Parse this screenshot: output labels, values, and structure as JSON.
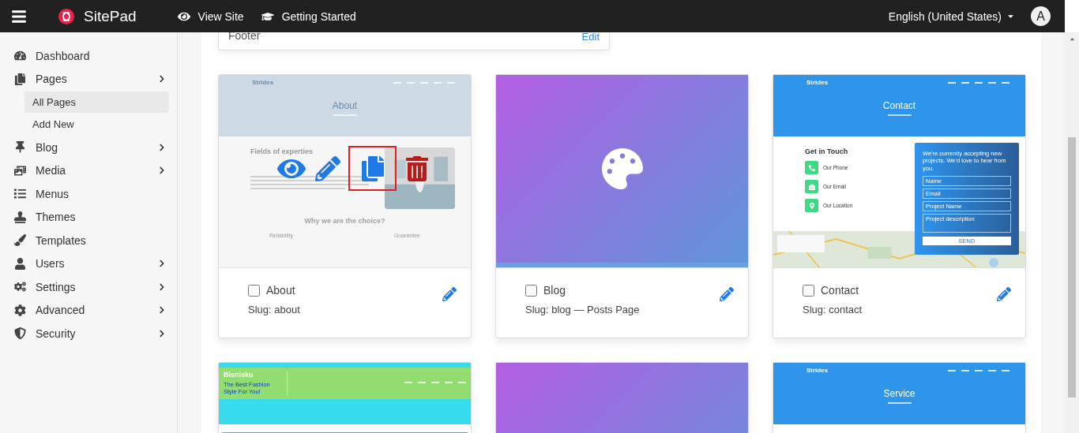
{
  "topbar": {
    "brand": "SitePad",
    "links": [
      {
        "label": "View Site"
      },
      {
        "label": "Getting Started"
      }
    ],
    "language": "English (United States)",
    "avatar": "A"
  },
  "sidebar": {
    "items": [
      {
        "label": "Dashboard",
        "has_submenu": false
      },
      {
        "label": "Pages",
        "has_submenu": true,
        "expanded": true,
        "children": [
          {
            "label": "All Pages",
            "selected": true
          },
          {
            "label": "Add New",
            "selected": false
          }
        ]
      },
      {
        "label": "Blog",
        "has_submenu": true,
        "expanded": false
      },
      {
        "label": "Media",
        "has_submenu": true,
        "expanded": false
      },
      {
        "label": "Menus",
        "has_submenu": false
      },
      {
        "label": "Themes",
        "has_submenu": false
      },
      {
        "label": "Templates",
        "has_submenu": false
      },
      {
        "label": "Users",
        "has_submenu": true,
        "expanded": false
      },
      {
        "label": "Settings",
        "has_submenu": true,
        "expanded": false
      },
      {
        "label": "Advanced",
        "has_submenu": true,
        "expanded": false
      },
      {
        "label": "Security",
        "has_submenu": true,
        "expanded": false
      }
    ]
  },
  "footer_box": {
    "label": "Footer",
    "action": "Edit"
  },
  "pages": [
    {
      "title": "About",
      "slug": "Slug: about",
      "checked": false,
      "hovered": true,
      "actions": [
        {
          "kind": "view",
          "highlighted": false
        },
        {
          "kind": "edit",
          "highlighted": false
        },
        {
          "kind": "copy",
          "highlighted": true
        },
        {
          "kind": "delete",
          "highlighted": false
        }
      ],
      "preview": {
        "kind": "site",
        "color": "#cddae5",
        "brand": "Strides",
        "heading": "About",
        "body": {
          "kind": "about",
          "title": "Fields of experties",
          "subtitle": "Why we are the choice?",
          "features": [
            "Reliability",
            "Guarantee"
          ]
        }
      }
    },
    {
      "title": "Blog",
      "slug": "Slug: blog — Posts Page",
      "checked": false,
      "hovered": false,
      "preview": {
        "kind": "placeholder",
        "icon": true
      }
    },
    {
      "title": "Contact",
      "slug": "Slug: contact",
      "checked": false,
      "hovered": false,
      "preview": {
        "kind": "site",
        "color": "#2f95ea",
        "brand": "Strides",
        "heading": "Contact",
        "body": {
          "kind": "contact",
          "title": "Get in Touch",
          "contacts": [
            "Our Phone",
            "Our Email",
            "Our Location"
          ],
          "intro": "We're currently accepting new projects. We'd love to hear from you.",
          "fields": [
            "Name",
            "Email",
            "Project Name",
            "Project description"
          ],
          "button": "SEND"
        }
      }
    },
    {
      "preview": {
        "kind": "site",
        "color": "#92dc72",
        "brand": "Bisnisku",
        "tagline": "The Best Fashion Style For You!"
      }
    },
    {
      "preview": {
        "kind": "placeholder"
      }
    },
    {
      "preview": {
        "kind": "site",
        "color": "#2f95ea",
        "brand": "Strides",
        "heading": "Service",
        "body": {
          "kind": "none"
        }
      }
    }
  ]
}
